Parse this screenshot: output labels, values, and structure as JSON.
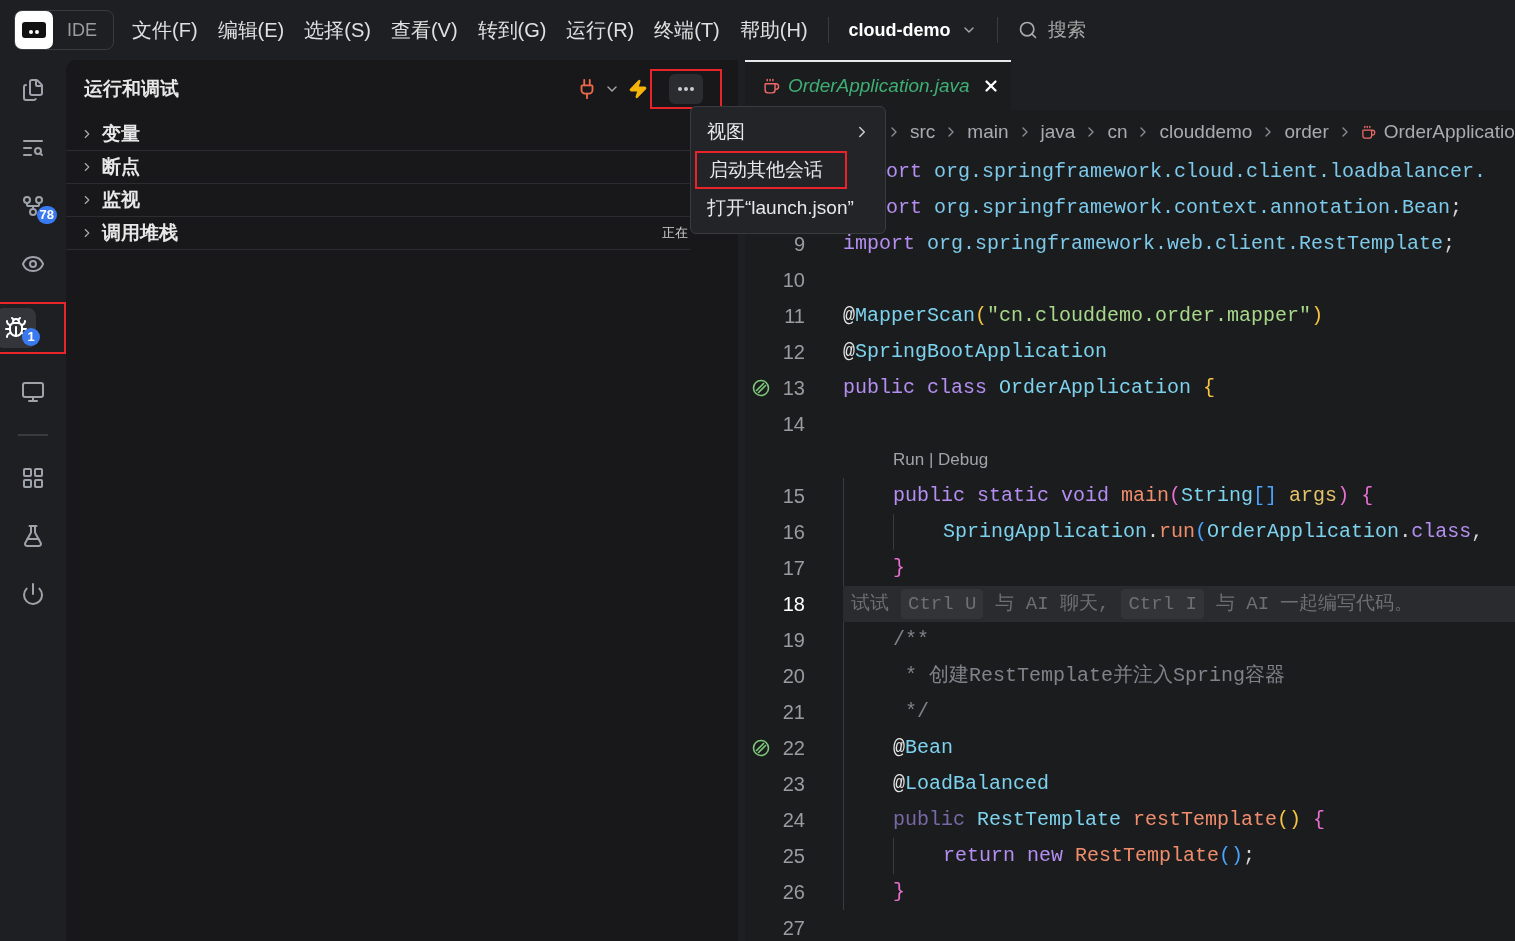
{
  "topbar": {
    "logo_text": "IDE",
    "menus": [
      "文件(F)",
      "编辑(E)",
      "选择(S)",
      "查看(V)",
      "转到(G)",
      "运行(R)",
      "终端(T)",
      "帮助(H)"
    ],
    "project": "cloud-demo",
    "search": {
      "placeholder": "搜索"
    }
  },
  "activity": [
    {
      "kind": "files",
      "selected": false,
      "highlighted": false
    },
    {
      "kind": "search",
      "selected": false,
      "highlighted": false
    },
    {
      "kind": "git",
      "selected": false,
      "highlighted": false,
      "badge": "78"
    },
    {
      "kind": "eye",
      "selected": false,
      "highlighted": false
    },
    {
      "kind": "debug",
      "selected": true,
      "highlighted": true,
      "badge": "1"
    },
    {
      "kind": "remote",
      "selected": false,
      "highlighted": false
    },
    {
      "kind": "divider"
    },
    {
      "kind": "extensions",
      "selected": false,
      "highlighted": false
    },
    {
      "kind": "flask",
      "selected": false,
      "highlighted": false
    },
    {
      "kind": "power",
      "selected": false,
      "highlighted": false
    }
  ],
  "panel": {
    "title": "运行和调试",
    "more_highlighted": true,
    "sections": [
      {
        "label": "变量",
        "expanded": false
      },
      {
        "label": "断点",
        "expanded": false
      },
      {
        "label": "监视",
        "expanded": false
      },
      {
        "label": "调用堆栈",
        "expanded": false,
        "status": "正在"
      }
    ]
  },
  "menu": {
    "items": [
      {
        "label": "视图",
        "submenu": true,
        "highlighted": false
      },
      {
        "label": "启动其他会话",
        "submenu": false,
        "highlighted": true
      },
      {
        "label": "打开“launch.json”",
        "submenu": false,
        "highlighted": false
      }
    ]
  },
  "editor": {
    "tab": {
      "label": "OrderApplication.java",
      "selected": true
    },
    "breadcrumb": [
      "src",
      "main",
      "java",
      "cn",
      "clouddemo",
      "order",
      "OrderApplicatio"
    ],
    "lines": [
      {
        "kind": "code",
        "hidden_prefix": true,
        "tokens": [
          {
            "text": "ort",
            "kind": "kw"
          },
          {
            "text": " org.springframework.cloud.client.loadbalancer.",
            "kind": "ident"
          }
        ]
      },
      {
        "kind": "code",
        "hidden_prefix": true,
        "tokens": [
          {
            "text": "ort",
            "kind": "kw"
          },
          {
            "text": " org.springframework.context.annotation.Bean",
            "kind": "ident"
          },
          {
            "text": ";",
            "kind": "punct"
          }
        ]
      },
      {
        "kind": "code",
        "number": "9",
        "tokens": [
          {
            "text": "import",
            "kind": "kw"
          },
          {
            "text": " org.springframework.web.client.RestTemplate",
            "kind": "ident"
          },
          {
            "text": ";",
            "kind": "punct"
          }
        ]
      },
      {
        "kind": "code",
        "number": "10"
      },
      {
        "kind": "code",
        "number": "11",
        "tokens": [
          {
            "text": "@",
            "kind": "annot"
          },
          {
            "text": "MapperScan",
            "kind": "type"
          },
          {
            "text": "(",
            "kind": "br1"
          },
          {
            "text": "\"cn.clouddemo.order.mapper\"",
            "kind": "str"
          },
          {
            "text": ")",
            "kind": "br1"
          }
        ]
      },
      {
        "kind": "code",
        "number": "12",
        "tokens": [
          {
            "text": "@",
            "kind": "annot"
          },
          {
            "text": "SpringBootApplication",
            "kind": "type"
          }
        ]
      },
      {
        "kind": "code",
        "number": "13",
        "run_icon": true,
        "tokens": [
          {
            "text": "public class ",
            "kind": "kw"
          },
          {
            "text": "OrderApplication ",
            "kind": "type"
          },
          {
            "text": "{",
            "kind": "br1"
          }
        ]
      },
      {
        "kind": "code",
        "number": "14"
      },
      {
        "kind": "codelens",
        "text": "Run | Debug"
      },
      {
        "kind": "code",
        "number": "15",
        "tokens": [
          {
            "text": "    public static void ",
            "kind": "kw"
          },
          {
            "text": "main",
            "kind": "fn"
          },
          {
            "text": "(",
            "kind": "br2"
          },
          {
            "text": "String",
            "kind": "type"
          },
          {
            "text": "[]",
            "kind": "br3"
          },
          {
            "text": " args",
            "kind": "param"
          },
          {
            "text": ") {",
            "kind": "br2"
          }
        ]
      },
      {
        "kind": "code",
        "number": "16",
        "tokens": [
          {
            "text": "        SpringApplication",
            "kind": "type"
          },
          {
            "text": ".",
            "kind": "punct"
          },
          {
            "text": "run",
            "kind": "fn"
          },
          {
            "text": "(",
            "kind": "br3"
          },
          {
            "text": "OrderApplication",
            "kind": "type"
          },
          {
            "text": ".",
            "kind": "punct"
          },
          {
            "text": "class",
            "kind": "kw"
          },
          {
            "text": ",",
            "kind": "punct"
          }
        ]
      },
      {
        "kind": "code",
        "number": "17",
        "tokens": [
          {
            "text": "    }",
            "kind": "br2"
          }
        ]
      },
      {
        "kind": "hint",
        "number": "18",
        "current": true,
        "parts": [
          {
            "text": "试试",
            "kind": "text"
          },
          {
            "text": "Ctrl U",
            "kind": "kbd"
          },
          {
            "text": "与 AI 聊天,",
            "kind": "text"
          },
          {
            "text": "Ctrl I",
            "kind": "kbd"
          },
          {
            "text": "与 AI 一起编写代码。",
            "kind": "text"
          }
        ]
      },
      {
        "kind": "code",
        "number": "19",
        "tokens": [
          {
            "text": "    /**",
            "kind": "comment"
          }
        ]
      },
      {
        "kind": "code",
        "number": "20",
        "tokens": [
          {
            "text": "     * 创建RestTemplate并注入Spring容器",
            "kind": "comment"
          }
        ]
      },
      {
        "kind": "code",
        "number": "21",
        "tokens": [
          {
            "text": "     */",
            "kind": "comment"
          }
        ]
      },
      {
        "kind": "code",
        "number": "22",
        "run_icon": true,
        "tokens": [
          {
            "text": "    @",
            "kind": "annot"
          },
          {
            "text": "Bean",
            "kind": "type"
          }
        ]
      },
      {
        "kind": "code",
        "number": "23",
        "tokens": [
          {
            "text": "    @",
            "kind": "annot"
          },
          {
            "text": "LoadBalanced",
            "kind": "type"
          }
        ]
      },
      {
        "kind": "code",
        "number": "24",
        "tokens": [
          {
            "text": "    public ",
            "kind": "kwdim"
          },
          {
            "text": "RestTemplate ",
            "kind": "type"
          },
          {
            "text": "restTemplate",
            "kind": "fn"
          },
          {
            "text": "()",
            "kind": "br1"
          },
          {
            "text": " {",
            "kind": "br2"
          }
        ]
      },
      {
        "kind": "code",
        "number": "25",
        "tokens": [
          {
            "text": "        return new ",
            "kind": "kw"
          },
          {
            "text": "RestTemplate",
            "kind": "fn"
          },
          {
            "text": "()",
            "kind": "br3"
          },
          {
            "text": ";",
            "kind": "punct"
          }
        ]
      },
      {
        "kind": "code",
        "number": "26",
        "tokens": [
          {
            "text": "    }",
            "kind": "br2"
          }
        ]
      },
      {
        "kind": "code",
        "number": "27"
      }
    ]
  }
}
